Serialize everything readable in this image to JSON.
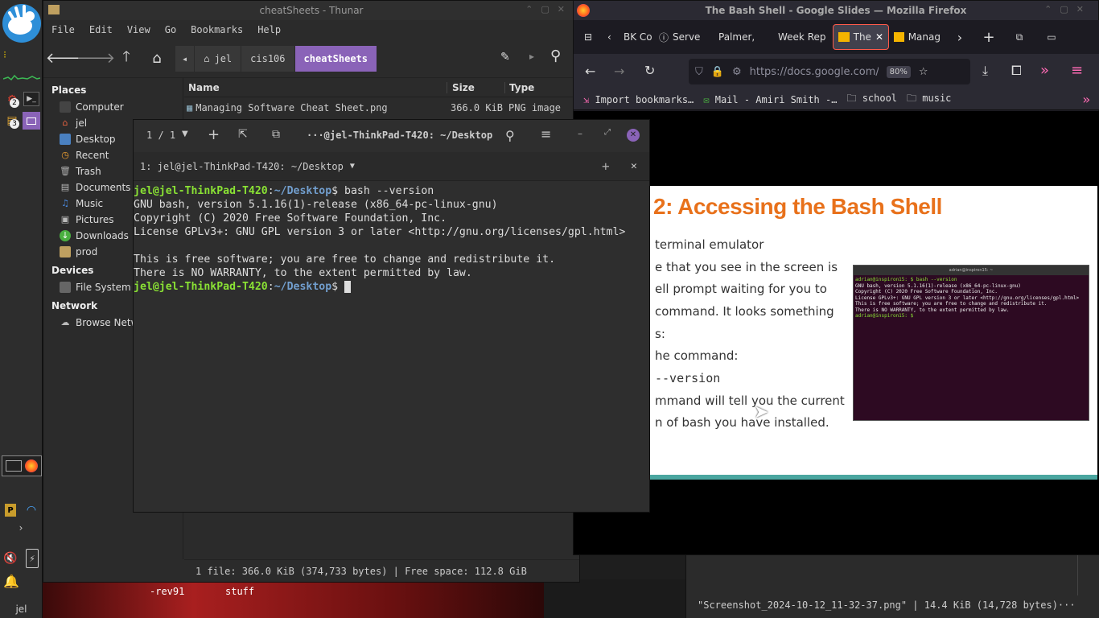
{
  "panel": {
    "workspace_badges": [
      "2",
      "3"
    ],
    "user_label": "jel"
  },
  "thunar": {
    "title": "cheatSheets - Thunar",
    "menu": [
      "File",
      "Edit",
      "View",
      "Go",
      "Bookmarks",
      "Help"
    ],
    "breadcrumbs": [
      "jel",
      "cis106",
      "cheatSheets"
    ],
    "sidebar": {
      "places_heading": "Places",
      "places": [
        "Computer",
        "jel",
        "Desktop",
        "Recent",
        "Trash",
        "Documents",
        "Music",
        "Pictures",
        "Downloads",
        "prod"
      ],
      "devices_heading": "Devices",
      "devices": [
        "File System"
      ],
      "network_heading": "Network",
      "network": [
        "Browse Network"
      ]
    },
    "columns": [
      "Name",
      "Size",
      "Type"
    ],
    "files": [
      {
        "name": "Managing Software Cheat Sheet.png",
        "size": "366.0 KiB",
        "type": "PNG image"
      }
    ],
    "status": "1 file: 366.0 KiB (374,733 bytes)  |  Free space: 112.8 GiB"
  },
  "terminal": {
    "tab_counter": "1 / 1",
    "title": "···@jel-ThinkPad-T420: ~/Desktop",
    "tab_label": "1: jel@jel-ThinkPad-T420: ~/Desktop",
    "prompt_user": "jel@jel-ThinkPad-T420",
    "prompt_path": "~/Desktop",
    "command": "bash --version",
    "output": [
      "GNU bash, version 5.1.16(1)-release (x86_64-pc-linux-gnu)",
      "Copyright (C) 2020 Free Software Foundation, Inc.",
      "License GPLv3+: GNU GPL version 3 or later <http://gnu.org/licenses/gpl.html>",
      "",
      "This is free software; you are free to change and redistribute it.",
      "There is NO WARRANTY, to the extent permitted by law."
    ]
  },
  "firefox": {
    "title": "The Bash Shell - Google Slides — Mozilla Firefox",
    "tabs": [
      "BK Co",
      "Serve",
      "Palmer,",
      "Week Rep",
      "The",
      "Manag"
    ],
    "url": "https://docs.google.com/pre",
    "zoom": "80%",
    "bookmarks": [
      "Import bookmarks…",
      "Mail - Amiri Smith -…",
      "school",
      "music"
    ],
    "slide": {
      "title": "2: Accessing the Bash Shell",
      "lines": [
        "terminal emulator",
        "e that you see in the screen is",
        "ell prompt waiting for you to",
        "command. It looks something",
        "s:",
        "he command:",
        "--version",
        "mmand will tell you the current",
        "n of bash you have installed."
      ],
      "mini_terminal": {
        "title": "adrian@inspiron15: ~",
        "lines": [
          "adrian@inspiron15: $ bash --version",
          "GNU bash, version 5.1.16(1)-release (x86_64-pc-linux-gnu)",
          "Copyright (C) 2020 Free Software Foundation, Inc.",
          "License GPLv3+: GNU GPL version 3 or later <http://gnu.org/licenses/gpl.html>",
          "",
          "This is free software; you are free to change and redistribute it.",
          "There is NO WARRANTY, to the extent permitted by law.",
          "adrian@inspiron15: $"
        ]
      }
    }
  },
  "background_window": {
    "status": "\"Screenshot_2024-10-12_11-32-37.png\"  |  14.4 KiB (14,728 bytes)···"
  },
  "desktop": {
    "icon_labels": [
      "-rev91",
      "stuff"
    ]
  },
  "colors": {
    "accent_purple": "#8a63b8",
    "prompt_green": "#8ae234",
    "prompt_blue": "#729fcf",
    "slide_orange": "#e8711b",
    "ff_tab_active": "#ff5a4a"
  }
}
